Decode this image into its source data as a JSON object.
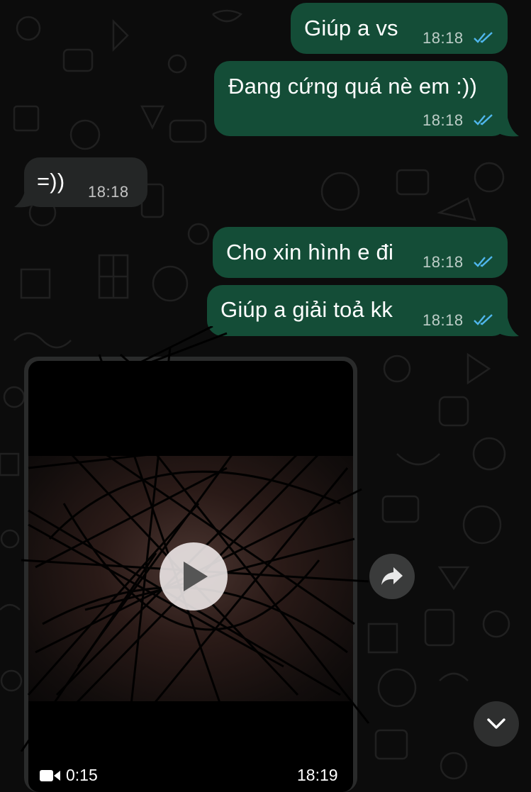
{
  "colors": {
    "outgoing_bubble": "#144d37",
    "incoming_bubble": "#242626",
    "read_ticks": "#4fb6ec",
    "background": "#0c0c0c"
  },
  "messages": [
    {
      "direction": "outgoing",
      "text": "Giúp a vs",
      "time": "18:18",
      "status": "read"
    },
    {
      "direction": "outgoing",
      "text": "Đang cứng quá nè em :))",
      "time": "18:18",
      "status": "read"
    },
    {
      "direction": "incoming",
      "text": "=))",
      "time": "18:18"
    },
    {
      "direction": "outgoing",
      "text": "Cho xin hình e đi",
      "time": "18:18",
      "status": "read"
    },
    {
      "direction": "outgoing",
      "text": "Giúp a giải toả kk",
      "time": "18:18",
      "status": "read"
    }
  ],
  "video_message": {
    "direction": "incoming",
    "duration": "0:15",
    "time": "18:19",
    "icons": {
      "play": "play-icon",
      "video": "video-camera-icon"
    }
  },
  "controls": {
    "forward_icon": "forward-arrow-icon",
    "scroll_down_icon": "chevron-down-icon"
  }
}
